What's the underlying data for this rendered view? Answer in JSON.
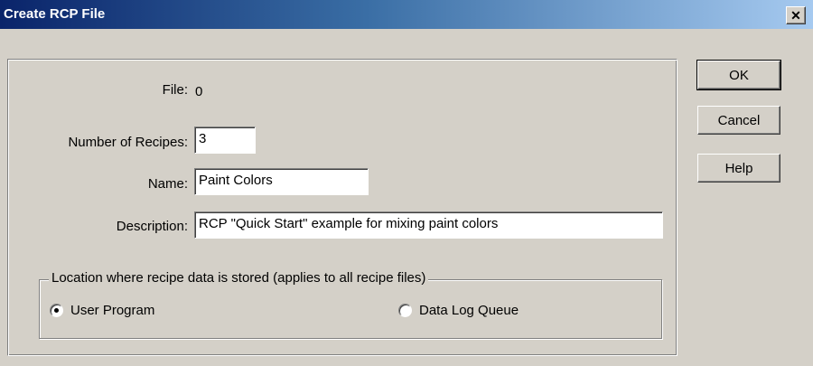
{
  "window": {
    "title": "Create RCP File",
    "close_glyph": "✕"
  },
  "form": {
    "file_label": "File:",
    "file_value": "0",
    "recipes_label": "Number of Recipes:",
    "recipes_value": "3",
    "name_label": "Name:",
    "name_value": "Paint Colors",
    "description_label": "Description:",
    "description_value": "RCP \"Quick Start\" example for mixing paint colors"
  },
  "location": {
    "legend": "Location where recipe data is stored  (applies to all recipe files)",
    "options": [
      {
        "label": "User Program",
        "selected": true
      },
      {
        "label": "Data Log Queue",
        "selected": false
      }
    ]
  },
  "buttons": {
    "ok": "OK",
    "cancel": "Cancel",
    "help": "Help"
  },
  "colors": {
    "titlebar_start": "#0a246a",
    "titlebar_end": "#a6caf0",
    "face": "#d4d0c8"
  }
}
